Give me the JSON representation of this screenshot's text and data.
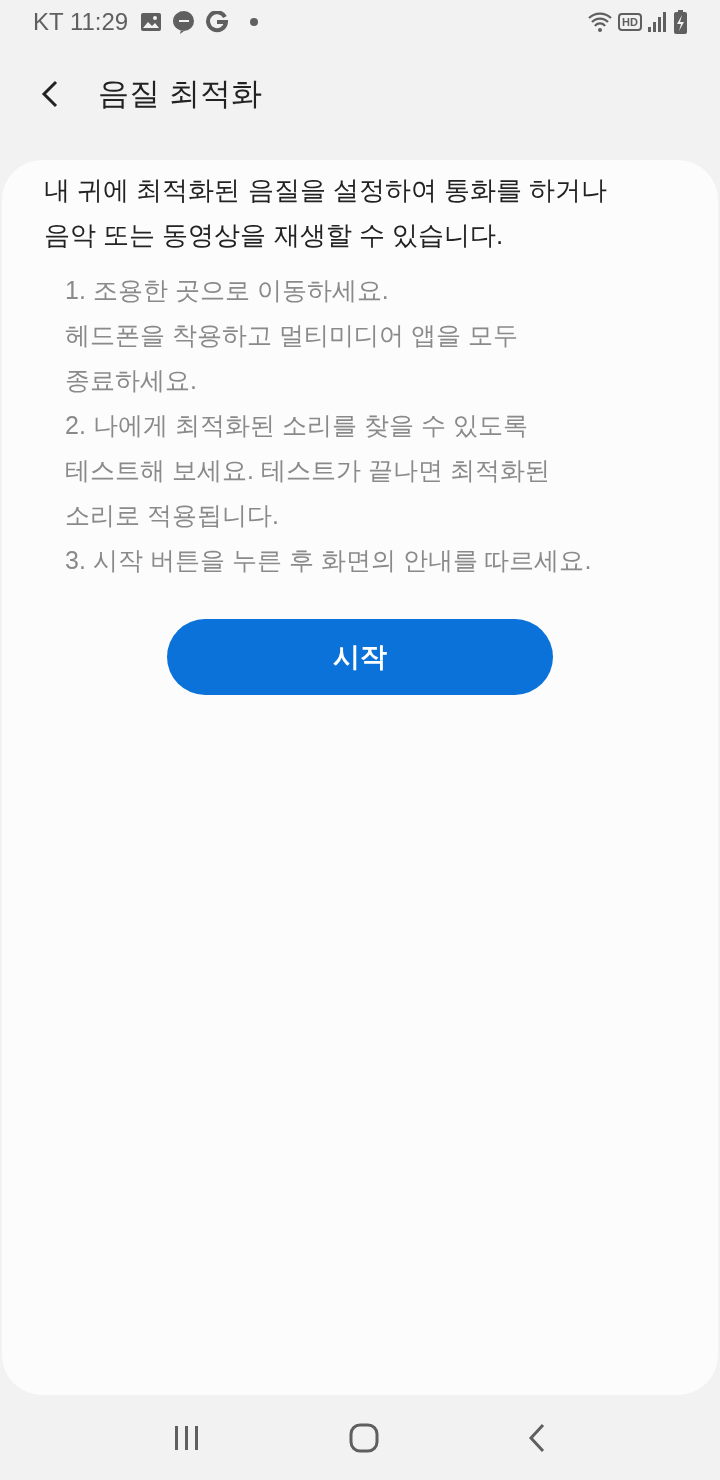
{
  "status_bar": {
    "carrier_time": "KT 11:29",
    "hd_label": "HD"
  },
  "header": {
    "title": "음질 최적화"
  },
  "intro_lines": [
    "내 귀에 최적화된 음질을 설정하여 통화를 하거나",
    "음악 또는 동영상을 재생할 수 있습니다."
  ],
  "step_lines": [
    "1. 조용한 곳으로 이동하세요.",
    "헤드폰을 착용하고 멀티미디어 앱을 모두",
    "종료하세요.",
    "2. 나에게 최적화된 소리를 찾을 수 있도록",
    "테스트해 보세요. 테스트가 끝나면 최적화된",
    "소리로 적용됩니다.",
    "3. 시작 버튼을 누른 후 화면의 안내를 따르세요."
  ],
  "start_button": {
    "label": "시작"
  }
}
